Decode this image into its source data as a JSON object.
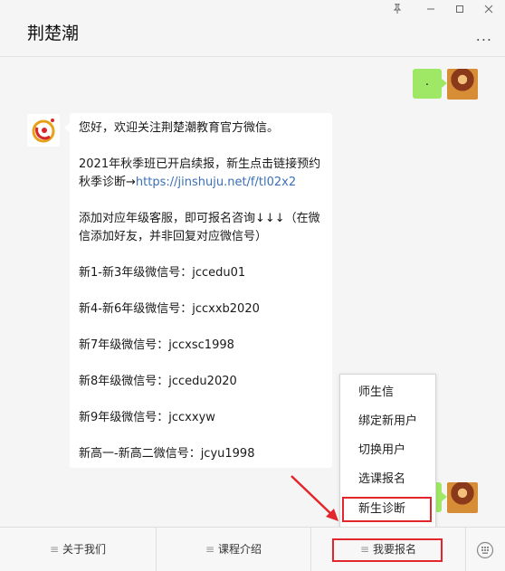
{
  "window": {
    "title": "荆楚潮",
    "controls": [
      "pin-icon",
      "minimize-icon",
      "maximize-icon",
      "close-icon"
    ],
    "more_label": "..."
  },
  "messages": {
    "sent_1": ".",
    "received": {
      "greeting": "您好，欢迎关注荆楚潮教育官方微信。",
      "enroll_line": "2021年秋季班已开启续报，新生点击链接预约秋季诊断→",
      "enroll_link": "https://jinshuju.net/f/tl02x2",
      "consult": "添加对应年级客服，即可报名咨询↓↓↓（在微信添加好友，并非回复对应微信号）",
      "g1_3": "新1-新3年级微信号：jccedu01",
      "g4_6": "新4-新6年级微信号：jccxxb2020",
      "g7": "新7年级微信号：jccxsc1998",
      "g8": "新8年级微信号：jccedu2020",
      "g9": "新9年级微信号：jccxxyw",
      "high": "新高一-新高二微信号：jcyu1998"
    }
  },
  "popup_menu": {
    "items": [
      "师生信",
      "绑定新用户",
      "切换用户",
      "选课报名",
      "新生诊断"
    ],
    "highlighted": "新生诊断"
  },
  "bottom_menu": {
    "items": [
      "关于我们",
      "课程介绍",
      "我要报名"
    ],
    "active": "我要报名"
  },
  "colors": {
    "sent_bubble": "#9fe865",
    "link": "#3c6fb6",
    "highlight": "#e2262c"
  }
}
